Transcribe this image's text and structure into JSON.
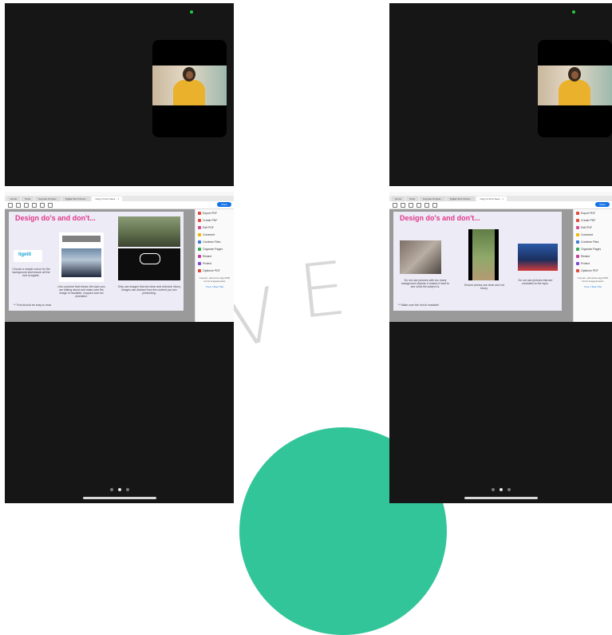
{
  "watermark": {
    "letters": [
      "V",
      "E"
    ],
    "accent_color": "#1dbf8f"
  },
  "phones": [
    {
      "pager_active": 2,
      "slide_title": "Design do's and don't...",
      "tabs": [
        "Home",
        "Tools",
        "Keynote Templa...",
        "Digital Tech Chemi...",
        "Copy of Intro Sess... ×"
      ],
      "share_label": "Share",
      "captions": [
        "Choose a simple colour for the background and ensure all the text is legible.",
        "Use a picture that shows the topic you are talking about and make sure the image is readable, cropped and not pixelated.",
        "Only use images that are clear and relevant; blurry images can distract from the content you are presenting."
      ],
      "footnote": "** Font should be easy to read",
      "logo_text": "ligetit",
      "panel_items": [
        "Export PDF",
        "Create PDF",
        "Edit PDF",
        "Comment",
        "Combine Files",
        "Organize Pages",
        "Redact",
        "Protect",
        "Optimize PDF"
      ],
      "panel_note": "Convert, edit and e-sign PDF forms & agreements",
      "panel_link": "Free 7-Day Trial"
    },
    {
      "pager_active": 2,
      "slide_title": "Design do's and don't...",
      "tabs": [
        "Home",
        "Tools",
        "Keynote Templa...",
        "Digital Tech Chemi...",
        "Copy of Intro Sess... ×"
      ],
      "share_label": "Share",
      "captions": [
        "Do not use pictures with too many background objects; it makes it hard to see what the subject is.",
        "Ensure photos are clear and not blurry.",
        "Do not use pictures that are unrelated to the topic."
      ],
      "footnote": "** Make sure the font is readable.",
      "panel_items": [
        "Export PDF",
        "Create PDF",
        "Edit PDF",
        "Comment",
        "Combine Files",
        "Organize Pages",
        "Redact",
        "Protect",
        "Optimize PDF"
      ],
      "panel_note": "Convert, edit and e-sign PDF forms & agreements",
      "panel_link": "Free 7-Day Trial"
    }
  ],
  "colors": {
    "phone_bg": "#161616",
    "slide_title": "#e3368a",
    "share_button": "#1473e6"
  }
}
